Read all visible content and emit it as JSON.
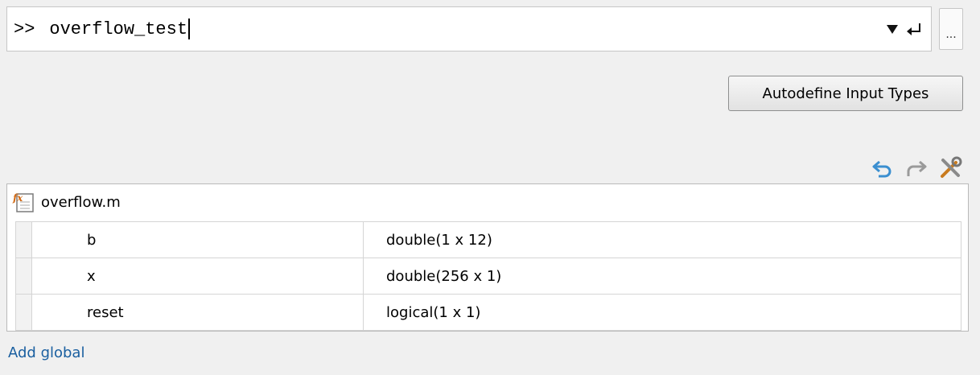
{
  "command": {
    "prompt": ">>",
    "value": "overflow_test"
  },
  "more_button": {
    "label": "..."
  },
  "autodefine_button": {
    "label": "Autodefine Input Types"
  },
  "toolbar": {
    "icons": [
      "undo-icon",
      "redo-icon",
      "settings-tools-icon"
    ]
  },
  "file": {
    "name": "overflow.m",
    "icon": "function-file-icon"
  },
  "variables": [
    {
      "name": "b",
      "type": "double(1 x 12)"
    },
    {
      "name": "x",
      "type": "double(256 x 1)"
    },
    {
      "name": "reset",
      "type": "logical(1 x 1)"
    }
  ],
  "add_global": {
    "label": "Add global"
  },
  "colors": {
    "link": "#1a5fa0",
    "undo_blue": "#3b8fd0",
    "redo_gray": "#9a9a9a"
  }
}
